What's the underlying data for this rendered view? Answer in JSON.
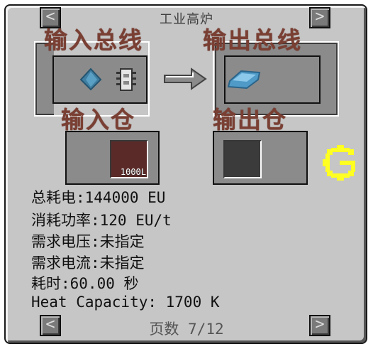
{
  "header": {
    "title": "工业高炉"
  },
  "nav": {
    "prev_glyph": "<",
    "next_glyph": ">"
  },
  "overlays": {
    "input_bus": "输入总线",
    "output_bus": "输出总线",
    "input_hatch": "输入仓",
    "output_hatch": "输出仓"
  },
  "input_fluid": {
    "amount_label": "1000L"
  },
  "info": {
    "total_eu": "总耗电:144000 EU",
    "eu_per_tick": "消耗功率:120 EU/t",
    "voltage": "需求电压:未指定",
    "amperage": "需求电流:未指定",
    "duration": "耗时:60.00 秒",
    "heat_capacity": "Heat Capacity: 1700 K"
  },
  "pager": {
    "text": "页数 7/12"
  },
  "icons": [
    "dust-icon",
    "circuit-icon",
    "arrow-right-icon",
    "ingot-icon",
    "gregtech-logo-icon"
  ],
  "colors": {
    "fluid": "#5a2a28",
    "output_tank": "#3b3b3b",
    "logo": "#ffff22",
    "overlay_text": "#7a3f33"
  }
}
